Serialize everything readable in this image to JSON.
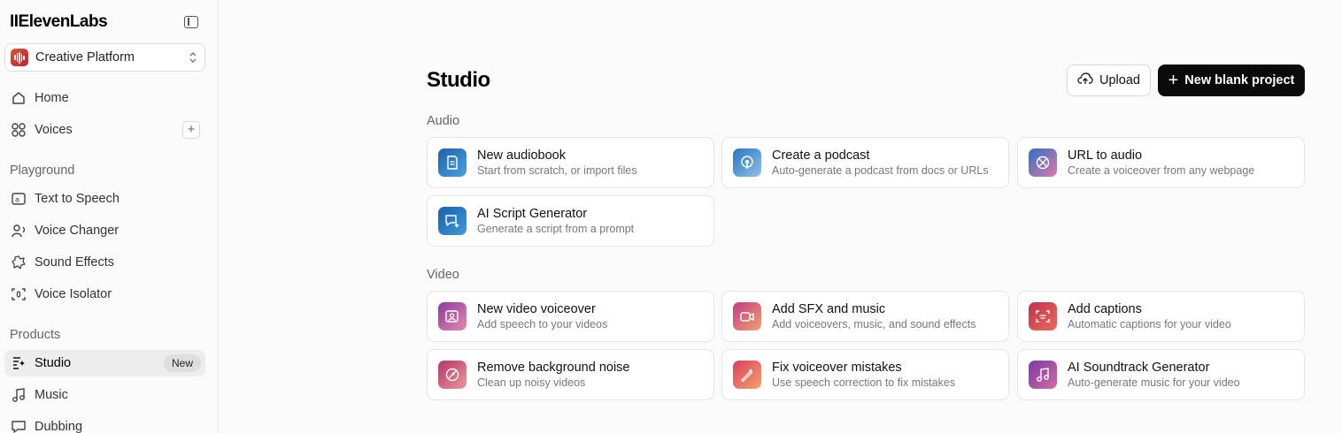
{
  "sidebar": {
    "logo": "IIElevenLabs",
    "workspace": "Creative Platform",
    "top_items": [
      {
        "label": "Home"
      },
      {
        "label": "Voices"
      }
    ],
    "playground_label": "Playground",
    "playground_items": [
      {
        "label": "Text to Speech"
      },
      {
        "label": "Voice Changer"
      },
      {
        "label": "Sound Effects"
      },
      {
        "label": "Voice Isolator"
      }
    ],
    "products_label": "Products",
    "products_items": [
      {
        "label": "Studio",
        "badge": "New"
      },
      {
        "label": "Music"
      },
      {
        "label": "Dubbing"
      }
    ]
  },
  "main": {
    "title": "Studio",
    "upload_label": "Upload",
    "new_project_label": "New blank project",
    "audio_label": "Audio",
    "audio_cards": [
      {
        "title": "New audiobook",
        "subtitle": "Start from scratch, or import files",
        "icon": "audiobook-icon"
      },
      {
        "title": "Create a podcast",
        "subtitle": "Auto-generate a podcast from docs or URLs",
        "icon": "podcast-icon"
      },
      {
        "title": "URL to audio",
        "subtitle": "Create a voiceover from any webpage",
        "icon": "url-icon"
      },
      {
        "title": "AI Script Generator",
        "subtitle": "Generate a script from a prompt",
        "icon": "script-icon"
      }
    ],
    "video_label": "Video",
    "video_cards": [
      {
        "title": "New video voiceover",
        "subtitle": "Add speech to your videos",
        "icon": "video-voiceover-icon"
      },
      {
        "title": "Add SFX and music",
        "subtitle": "Add voiceovers, music, and sound effects",
        "icon": "sfx-icon"
      },
      {
        "title": "Add captions",
        "subtitle": "Automatic captions for your video",
        "icon": "captions-icon"
      },
      {
        "title": "Remove background noise",
        "subtitle": "Clean up noisy videos",
        "icon": "noise-icon"
      },
      {
        "title": "Fix voiceover mistakes",
        "subtitle": "Use speech correction to fix mistakes",
        "icon": "fix-icon"
      },
      {
        "title": "AI Soundtrack Generator",
        "subtitle": "Auto-generate music for your video",
        "icon": "soundtrack-icon"
      }
    ]
  },
  "colors": {
    "accent_dark": "#0a0a0a",
    "audio_tile": "#2a6fb8",
    "video_tile": "#b8337a"
  }
}
